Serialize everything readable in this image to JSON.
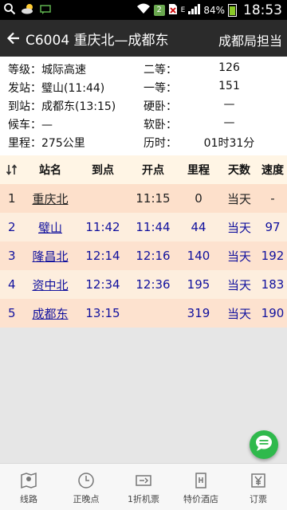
{
  "status_bar": {
    "badge": "2",
    "signal_letter": "E",
    "battery": "84%",
    "time": "18:53"
  },
  "header": {
    "title": "C6004 重庆北—成都东",
    "right_label": "成都局担当"
  },
  "info": {
    "grade_label": "等级：",
    "grade_value": "城际高速",
    "second_class_label": "二等：",
    "second_class_value": "126",
    "departure_label": "发站：",
    "departure_value": "璧山(11:44)",
    "first_class_label": "一等：",
    "first_class_value": "151",
    "arrival_label": "到站：",
    "arrival_value": "成都东(13:15)",
    "hard_sleeper_label": "硬卧：",
    "hard_sleeper_value": "—",
    "waiting_label": "候车：",
    "waiting_value": "—",
    "soft_sleeper_label": "软卧：",
    "soft_sleeper_value": "—",
    "distance_label": "里程：",
    "distance_value": "275公里",
    "duration_label": "历时：",
    "duration_value": "01时31分"
  },
  "table": {
    "headers": [
      "↓↑",
      "站名",
      "到点",
      "开点",
      "里程",
      "天数",
      "速度"
    ],
    "rows": [
      {
        "no": "1",
        "station": "重庆北",
        "arrive": "",
        "depart": "11:15",
        "distance": "0",
        "day": "当天",
        "speed": "-"
      },
      {
        "no": "2",
        "station": "璧山",
        "arrive": "11:42",
        "depart": "11:44",
        "distance": "44",
        "day": "当天",
        "speed": "97"
      },
      {
        "no": "3",
        "station": "隆昌北",
        "arrive": "12:14",
        "depart": "12:16",
        "distance": "140",
        "day": "当天",
        "speed": "192"
      },
      {
        "no": "4",
        "station": "资中北",
        "arrive": "12:34",
        "depart": "12:36",
        "distance": "195",
        "day": "当天",
        "speed": "183"
      },
      {
        "no": "5",
        "station": "成都东",
        "arrive": "13:15",
        "depart": "",
        "distance": "319",
        "day": "当天",
        "speed": "190"
      }
    ]
  },
  "bottom_nav": [
    {
      "label": "线路",
      "icon": "map-pin-icon"
    },
    {
      "label": "正晚点",
      "icon": "clock-icon"
    },
    {
      "label": "1折机票",
      "icon": "ticket-icon"
    },
    {
      "label": "特价酒店",
      "icon": "hotel-icon"
    },
    {
      "label": "订票",
      "icon": "yen-ticket-icon"
    }
  ],
  "colors": {
    "header_bg": "#2b2b2b",
    "row_highlight": "#fde0cb",
    "row_light": "#fdeede",
    "link_blue": "#11119e",
    "fab_green": "#2fb94c"
  }
}
